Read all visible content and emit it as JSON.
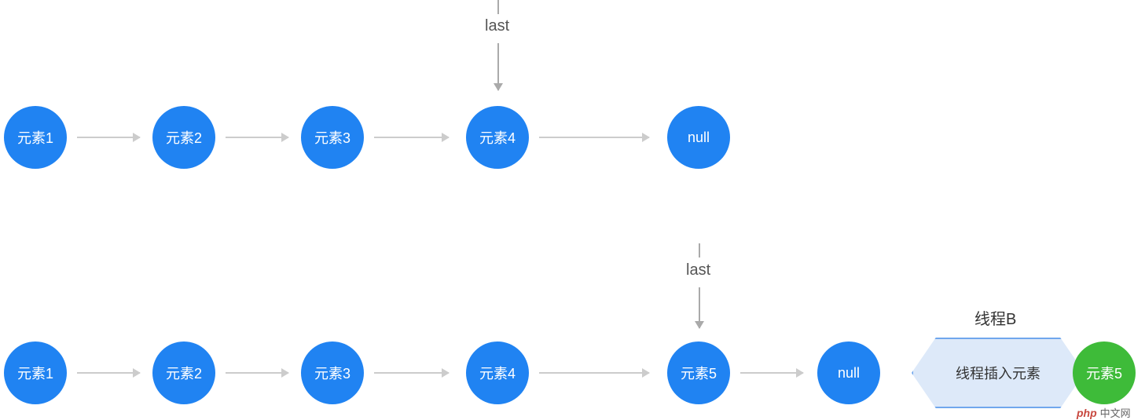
{
  "row1": {
    "last_label": "last",
    "nodes": [
      "元素1",
      "元素2",
      "元素3",
      "元素4",
      "null"
    ]
  },
  "row2": {
    "last_label": "last",
    "nodes": [
      "元素1",
      "元素2",
      "元素3",
      "元素4",
      "元素5",
      "null"
    ]
  },
  "threadB": {
    "title": "线程B",
    "action": "线程插入元素",
    "node": "元素5"
  },
  "watermark": {
    "logo": "php",
    "text": "中文网"
  }
}
